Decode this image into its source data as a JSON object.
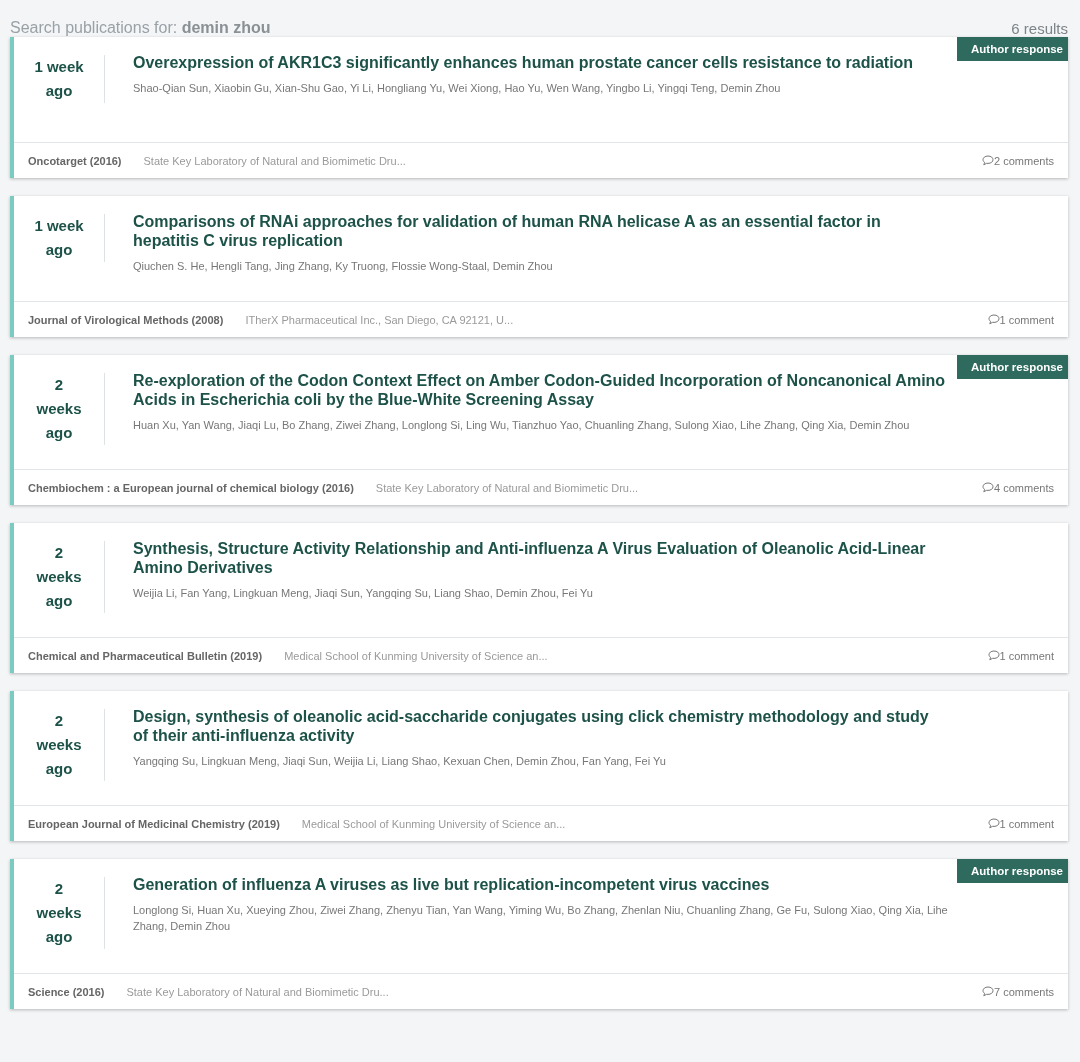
{
  "search": {
    "label": "Search publications for:",
    "query": "demin zhou"
  },
  "results_count": "6 results",
  "publications": [
    {
      "age": "1 week ago",
      "title": "Overexpression of AKR1C3 significantly enhances human prostate cancer cells resistance to radiation",
      "authors": "Shao-Qian Sun, Xiaobin Gu, Xian-Shu Gao, Yi Li, Hongliang Yu, Wei Xiong, Hao Yu, Wen Wang, Yingbo Li, Yingqi Teng, Demin Zhou",
      "journal": "Oncotarget (2016)",
      "affiliation": "State Key Laboratory of Natural and Biomimetic Dru...",
      "comments": "2 comments",
      "author_response": "Author response"
    },
    {
      "age": "1 week ago",
      "title": "Comparisons of RNAi approaches for validation of human RNA helicase A as an essential factor in hepatitis C virus replication",
      "authors": "Qiuchen S. He, Hengli Tang, Jing Zhang, Ky Truong, Flossie Wong-Staal, Demin Zhou",
      "journal": "Journal of Virological Methods (2008)",
      "affiliation": "ITherX Pharmaceutical Inc., San Diego, CA 92121, U...",
      "comments": "1 comment"
    },
    {
      "age": "2 weeks ago",
      "title": "Re-exploration of the Codon Context Effect on Amber Codon-Guided Incorporation of Noncanonical Amino Acids in Escherichia coli by the Blue-White Screening Assay",
      "authors": "Huan Xu, Yan Wang, Jiaqi Lu, Bo Zhang, Ziwei Zhang, Longlong Si, Ling Wu, Tianzhuo Yao, Chuanling Zhang, Sulong Xiao, Lihe Zhang, Qing Xia, Demin Zhou",
      "journal": "Chembiochem : a European journal of chemical biology (2016)",
      "affiliation": "State Key Laboratory of Natural and Biomimetic Dru...",
      "comments": "4 comments",
      "author_response": "Author response"
    },
    {
      "age": "2 weeks ago",
      "title": "Synthesis, Structure Activity Relationship and Anti-influenza A Virus Evaluation of Oleanolic Acid-Linear Amino Derivatives",
      "authors": "Weijia Li, Fan Yang, Lingkuan Meng, Jiaqi Sun, Yangqing Su, Liang Shao, Demin Zhou, Fei Yu",
      "journal": "Chemical and Pharmaceutical Bulletin (2019)",
      "affiliation": "Medical School of Kunming University of Science an...",
      "comments": "1 comment"
    },
    {
      "age": "2 weeks ago",
      "title": "Design, synthesis of oleanolic acid-saccharide conjugates using click chemistry methodology and study of their anti-influenza activity",
      "authors": "Yangqing Su, Lingkuan Meng, Jiaqi Sun, Weijia Li, Liang Shao, Kexuan Chen, Demin Zhou, Fan Yang, Fei Yu",
      "journal": "European Journal of Medicinal Chemistry (2019)",
      "affiliation": "Medical School of Kunming University of Science an...",
      "comments": "1 comment"
    },
    {
      "age": "2 weeks ago",
      "title": "Generation of influenza A viruses as live but replication-incompetent virus vaccines",
      "authors": "Longlong Si, Huan Xu, Xueying Zhou, Ziwei Zhang, Zhenyu Tian, Yan Wang, Yiming Wu, Bo Zhang, Zhenlan Niu, Chuanling Zhang, Ge Fu, Sulong Xiao, Qing Xia, Lihe Zhang, Demin Zhou",
      "journal": "Science (2016)",
      "affiliation": "State Key Laboratory of Natural and Biomimetic Dru...",
      "comments": "7 comments",
      "author_response": "Author response"
    }
  ]
}
